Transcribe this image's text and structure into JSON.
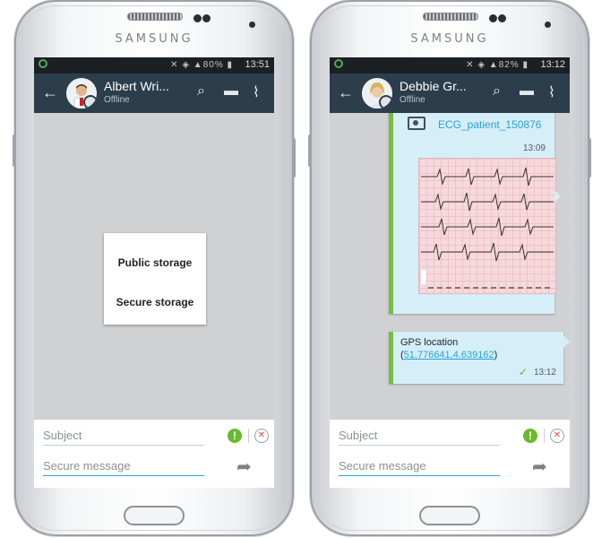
{
  "colors": {
    "appbar": "#2c3e4c",
    "accent_blue": "#29a3d6",
    "accent_green": "#72c040",
    "bubble": "#d5eef8",
    "priority_green": "#66bb2e"
  },
  "left_phone": {
    "brand": "SAMSUNG",
    "status": {
      "battery": "80%",
      "time": "13:51"
    },
    "contact": {
      "name": "Albert Wri...",
      "status": "Offline"
    },
    "popup": {
      "option1": "Public storage",
      "option2": "Secure storage"
    },
    "composer": {
      "subject_placeholder": "Subject",
      "message_placeholder": "Secure message"
    },
    "icons": [
      "back-arrow-icon",
      "search-icon",
      "contact-card-icon",
      "attachment-icon",
      "priority-icon",
      "expiry-icon",
      "send-icon"
    ]
  },
  "right_phone": {
    "brand": "SAMSUNG",
    "status": {
      "battery": "82%",
      "time": "13:12"
    },
    "contact": {
      "name": "Debbie Gr...",
      "status": "Offline"
    },
    "attachment": {
      "name": "ECG_patient_150876",
      "time": "13:09"
    },
    "gps": {
      "label": "GPS location",
      "open": "(",
      "coords": "51.776641,4.639162",
      "close": ")",
      "time": "13:12"
    },
    "composer": {
      "subject_placeholder": "Subject",
      "message_placeholder": "Secure message"
    },
    "icons": [
      "back-arrow-icon",
      "search-icon",
      "contact-card-icon",
      "attachment-icon",
      "camera-icon",
      "check-icon",
      "priority-icon",
      "expiry-icon",
      "send-icon"
    ]
  }
}
